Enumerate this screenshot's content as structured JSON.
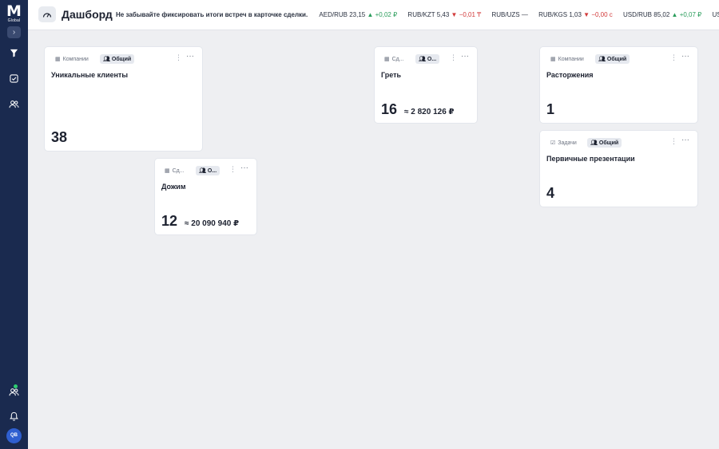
{
  "sidebar": {
    "logo_letter": "M",
    "logo_sub": "Global",
    "avatar_initials": "QB",
    "icons": [
      "expand-icon",
      "filter-icon",
      "tasks-check-icon",
      "users-icon",
      "team-icon",
      "bell-icon"
    ]
  },
  "header": {
    "title": "Дашборд",
    "notice": "Не забывайте фиксировать итоги встреч в карточке сделки.",
    "rates": [
      {
        "pair": "AED/RUB",
        "value": "23,15",
        "change": "+0,02 ₽",
        "dir": "up"
      },
      {
        "pair": "RUB/KZT",
        "value": "5,43",
        "change": "−0,01 ₸",
        "dir": "down"
      },
      {
        "pair": "RUB/UZS",
        "value": "—",
        "change": "",
        "dir": "flat"
      },
      {
        "pair": "RUB/KGS",
        "value": "1,03",
        "change": "−0,00 c",
        "dir": "down"
      },
      {
        "pair": "USD/RUB",
        "value": "85,02",
        "change": "+0,07 ₽",
        "dir": "up"
      },
      {
        "pair": "USD/EUR",
        "value": "",
        "change": "",
        "dir": "flat"
      }
    ]
  },
  "widgets": [
    {
      "type": "Компании",
      "scope": "Общий",
      "title": "Уникальные клиенты",
      "value": "38",
      "sum": ""
    },
    {
      "type": "Сд...",
      "scope": "О...",
      "title": "Дожим",
      "value": "12",
      "sum": "≈ 20 090 940 ₽"
    },
    {
      "type": "Сд...",
      "scope": "О...",
      "title": "Греть",
      "value": "16",
      "sum": "≈ 2 820 126 ₽"
    },
    {
      "type": "Компании",
      "scope": "Общий",
      "title": "Расторжения",
      "value": "1",
      "sum": ""
    },
    {
      "type": "Задачи",
      "scope": "Общий",
      "title": "Первичные презентации",
      "value": "4",
      "sum": ""
    }
  ],
  "colors": {
    "sidebar": "#1a2a4f",
    "up": "#2a9d5b",
    "down": "#d23b3b",
    "avatar": "#2f5fd0"
  }
}
